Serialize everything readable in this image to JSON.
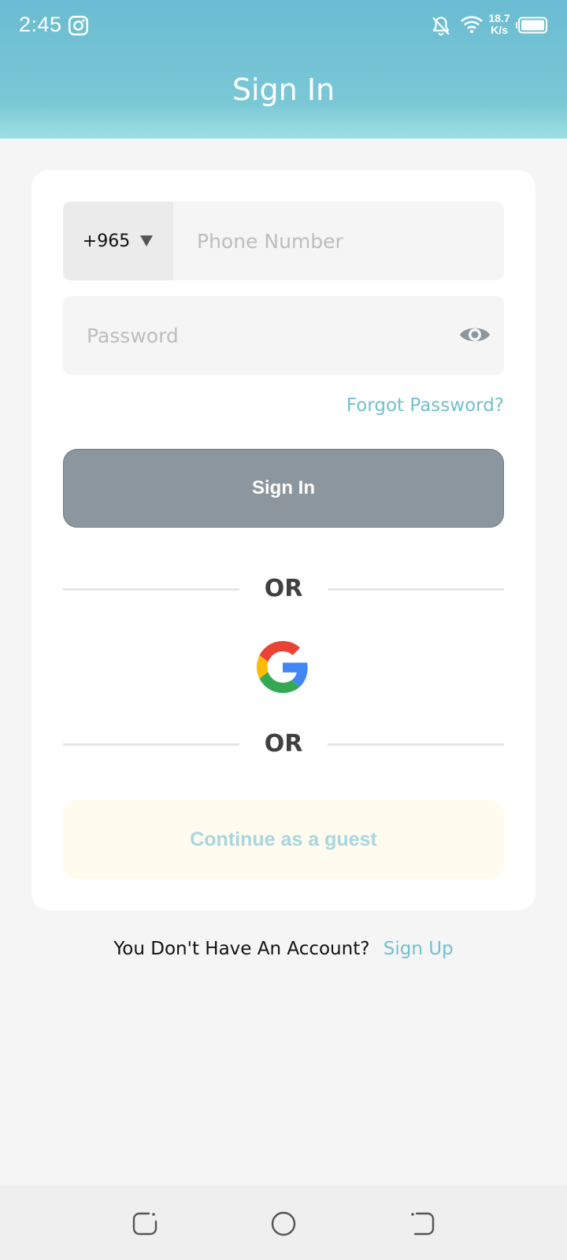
{
  "status_bar": {
    "time": "2:45",
    "speed_value": "18.7",
    "speed_unit": "K/s",
    "icons": [
      "instagram-icon",
      "bell-off-icon",
      "wifi-icon",
      "battery-icon"
    ]
  },
  "header": {
    "title": "Sign In"
  },
  "form": {
    "country_code": "+965",
    "phone_placeholder": "Phone Number",
    "password_placeholder": "Password",
    "forgot_password": "Forgot Password?",
    "signin_label": "Sign In",
    "or_label_1": "OR",
    "or_label_2": "OR",
    "guest_label": "Continue as a guest"
  },
  "signup": {
    "prompt": "You Don't Have An Account?",
    "link": "Sign Up"
  },
  "nav": {
    "icons": [
      "recents-icon",
      "home-icon",
      "back-icon"
    ]
  },
  "colors": {
    "header_top": "#6bbcd2",
    "header_bottom": "#9ee0e2",
    "accent": "#72c0d0",
    "signin_button": "#8b969e",
    "guest_button_bg": "#fffbee",
    "guest_button_text": "#a8d6df"
  }
}
